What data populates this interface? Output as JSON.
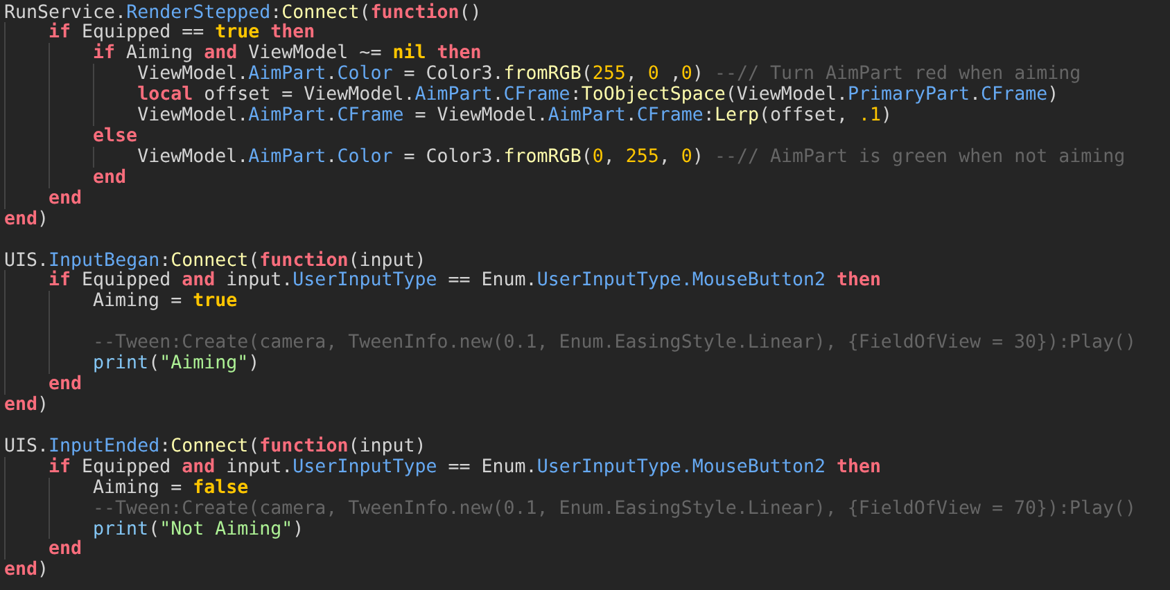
{
  "editor": {
    "lines": [
      {
        "tokens": [
          {
            "kind": "plain",
            "text": "RunService."
          },
          {
            "kind": "member",
            "text": "RenderStepped"
          },
          {
            "kind": "plain",
            "text": ":"
          },
          {
            "kind": "method",
            "text": "Connect"
          },
          {
            "kind": "plain",
            "text": "("
          },
          {
            "kind": "keyword",
            "text": "function"
          },
          {
            "kind": "plain",
            "text": "()"
          }
        ],
        "children": [
          {
            "tokens": [
              {
                "kind": "keyword",
                "text": "if"
              },
              {
                "kind": "plain",
                "text": " Equipped == "
              },
              {
                "kind": "literal",
                "text": "true "
              },
              {
                "kind": "keyword",
                "text": "then"
              }
            ],
            "children": [
              {
                "tokens": [
                  {
                    "kind": "keyword",
                    "text": "if"
                  },
                  {
                    "kind": "plain",
                    "text": " Aiming "
                  },
                  {
                    "kind": "keyword",
                    "text": "and"
                  },
                  {
                    "kind": "plain",
                    "text": " ViewModel ~= "
                  },
                  {
                    "kind": "literal",
                    "text": "nil "
                  },
                  {
                    "kind": "keyword",
                    "text": "then"
                  }
                ],
                "children": [
                  {
                    "tokens": [
                      {
                        "kind": "plain",
                        "text": "ViewModel."
                      },
                      {
                        "kind": "member",
                        "text": "AimPart"
                      },
                      {
                        "kind": "plain",
                        "text": "."
                      },
                      {
                        "kind": "member",
                        "text": "Color"
                      },
                      {
                        "kind": "plain",
                        "text": " = Color3."
                      },
                      {
                        "kind": "method",
                        "text": "fromRGB"
                      },
                      {
                        "kind": "plain",
                        "text": "("
                      },
                      {
                        "kind": "number",
                        "text": "255"
                      },
                      {
                        "kind": "plain",
                        "text": ", "
                      },
                      {
                        "kind": "number",
                        "text": "0"
                      },
                      {
                        "kind": "plain",
                        "text": " ,"
                      },
                      {
                        "kind": "number",
                        "text": "0"
                      },
                      {
                        "kind": "plain",
                        "text": ") "
                      },
                      {
                        "kind": "comment",
                        "text": "--// Turn AimPart red when aiming"
                      }
                    ]
                  },
                  {
                    "tokens": [
                      {
                        "kind": "keyword",
                        "text": "local"
                      },
                      {
                        "kind": "plain",
                        "text": " offset = ViewModel."
                      },
                      {
                        "kind": "member",
                        "text": "AimPart"
                      },
                      {
                        "kind": "plain",
                        "text": "."
                      },
                      {
                        "kind": "member",
                        "text": "CFrame"
                      },
                      {
                        "kind": "plain",
                        "text": ":"
                      },
                      {
                        "kind": "method",
                        "text": "ToObjectSpace"
                      },
                      {
                        "kind": "plain",
                        "text": "(ViewModel."
                      },
                      {
                        "kind": "member",
                        "text": "PrimaryPart"
                      },
                      {
                        "kind": "plain",
                        "text": "."
                      },
                      {
                        "kind": "member",
                        "text": "CFrame"
                      },
                      {
                        "kind": "plain",
                        "text": ")"
                      }
                    ]
                  },
                  {
                    "tokens": [
                      {
                        "kind": "plain",
                        "text": "ViewModel."
                      },
                      {
                        "kind": "member",
                        "text": "AimPart"
                      },
                      {
                        "kind": "plain",
                        "text": "."
                      },
                      {
                        "kind": "member",
                        "text": "CFrame"
                      },
                      {
                        "kind": "plain",
                        "text": " = ViewModel."
                      },
                      {
                        "kind": "member",
                        "text": "AimPart"
                      },
                      {
                        "kind": "plain",
                        "text": "."
                      },
                      {
                        "kind": "member",
                        "text": "CFrame"
                      },
                      {
                        "kind": "plain",
                        "text": ":"
                      },
                      {
                        "kind": "method",
                        "text": "Lerp"
                      },
                      {
                        "kind": "plain",
                        "text": "(offset, "
                      },
                      {
                        "kind": "number",
                        "text": ".1"
                      },
                      {
                        "kind": "plain",
                        "text": ")"
                      }
                    ]
                  }
                ]
              },
              {
                "tokens": [
                  {
                    "kind": "keyword",
                    "text": "else"
                  }
                ],
                "children": [
                  {
                    "tokens": [
                      {
                        "kind": "plain",
                        "text": "ViewModel."
                      },
                      {
                        "kind": "member",
                        "text": "AimPart"
                      },
                      {
                        "kind": "plain",
                        "text": "."
                      },
                      {
                        "kind": "member",
                        "text": "Color"
                      },
                      {
                        "kind": "plain",
                        "text": " = Color3."
                      },
                      {
                        "kind": "method",
                        "text": "fromRGB"
                      },
                      {
                        "kind": "plain",
                        "text": "("
                      },
                      {
                        "kind": "number",
                        "text": "0"
                      },
                      {
                        "kind": "plain",
                        "text": ", "
                      },
                      {
                        "kind": "number",
                        "text": "255"
                      },
                      {
                        "kind": "plain",
                        "text": ", "
                      },
                      {
                        "kind": "number",
                        "text": "0"
                      },
                      {
                        "kind": "plain",
                        "text": ") "
                      },
                      {
                        "kind": "comment",
                        "text": "--// AimPart is green when not aiming"
                      }
                    ]
                  }
                ]
              },
              {
                "tokens": [
                  {
                    "kind": "keyword",
                    "text": "end"
                  }
                ]
              }
            ]
          },
          {
            "tokens": [
              {
                "kind": "keyword",
                "text": "end"
              }
            ]
          }
        ]
      },
      {
        "tokens": [
          {
            "kind": "keyword",
            "text": "end"
          },
          {
            "kind": "plain",
            "text": ")"
          }
        ]
      },
      {
        "kind": "blank"
      },
      {
        "tokens": [
          {
            "kind": "plain",
            "text": "UIS."
          },
          {
            "kind": "member",
            "text": "InputBegan"
          },
          {
            "kind": "plain",
            "text": ":"
          },
          {
            "kind": "method",
            "text": "Connect"
          },
          {
            "kind": "plain",
            "text": "("
          },
          {
            "kind": "keyword",
            "text": "function"
          },
          {
            "kind": "plain",
            "text": "(input)"
          }
        ],
        "children": [
          {
            "tokens": [
              {
                "kind": "keyword",
                "text": "if"
              },
              {
                "kind": "plain",
                "text": " Equipped "
              },
              {
                "kind": "keyword",
                "text": "and"
              },
              {
                "kind": "plain",
                "text": " input."
              },
              {
                "kind": "member",
                "text": "UserInputType"
              },
              {
                "kind": "plain",
                "text": " == Enum."
              },
              {
                "kind": "member",
                "text": "UserInputType"
              },
              {
                "kind": "member",
                "text": ".MouseButton2 "
              },
              {
                "kind": "keyword",
                "text": "then"
              }
            ],
            "children": [
              {
                "tokens": [
                  {
                    "kind": "plain",
                    "text": "Aiming = "
                  },
                  {
                    "kind": "literal",
                    "text": "true"
                  }
                ]
              },
              {
                "kind": "blank"
              },
              {
                "tokens": [
                  {
                    "kind": "comment",
                    "text": "--Tween:Create(camera, TweenInfo.new(0.1, Enum.EasingStyle.Linear), {FieldOfView = 30}):Play()"
                  }
                ]
              },
              {
                "tokens": [
                  {
                    "kind": "builtin",
                    "text": "print"
                  },
                  {
                    "kind": "plain",
                    "text": "("
                  },
                  {
                    "kind": "string",
                    "text": "\"Aiming\""
                  },
                  {
                    "kind": "plain",
                    "text": ")"
                  }
                ]
              }
            ]
          },
          {
            "tokens": [
              {
                "kind": "keyword",
                "text": "end"
              }
            ]
          }
        ]
      },
      {
        "tokens": [
          {
            "kind": "keyword",
            "text": "end"
          },
          {
            "kind": "plain",
            "text": ")"
          }
        ]
      },
      {
        "kind": "blank"
      },
      {
        "tokens": [
          {
            "kind": "plain",
            "text": "UIS."
          },
          {
            "kind": "member",
            "text": "InputEnded"
          },
          {
            "kind": "plain",
            "text": ":"
          },
          {
            "kind": "method",
            "text": "Connect"
          },
          {
            "kind": "plain",
            "text": "("
          },
          {
            "kind": "keyword",
            "text": "function"
          },
          {
            "kind": "plain",
            "text": "(input)"
          }
        ],
        "children": [
          {
            "tokens": [
              {
                "kind": "keyword",
                "text": "if"
              },
              {
                "kind": "plain",
                "text": " Equipped "
              },
              {
                "kind": "keyword",
                "text": "and"
              },
              {
                "kind": "plain",
                "text": " input."
              },
              {
                "kind": "member",
                "text": "UserInputType"
              },
              {
                "kind": "plain",
                "text": " == Enum."
              },
              {
                "kind": "member",
                "text": "UserInputType"
              },
              {
                "kind": "member",
                "text": ".MouseButton2 "
              },
              {
                "kind": "keyword",
                "text": "then"
              }
            ],
            "children": [
              {
                "tokens": [
                  {
                    "kind": "plain",
                    "text": "Aiming = "
                  },
                  {
                    "kind": "literal",
                    "text": "false"
                  }
                ]
              },
              {
                "tokens": [
                  {
                    "kind": "comment",
                    "text": "--Tween:Create(camera, TweenInfo.new(0.1, Enum.EasingStyle.Linear), {FieldOfView = 70}):Play()"
                  }
                ]
              },
              {
                "tokens": [
                  {
                    "kind": "builtin",
                    "text": "print"
                  },
                  {
                    "kind": "plain",
                    "text": "("
                  },
                  {
                    "kind": "string",
                    "text": "\"Not Aiming\""
                  },
                  {
                    "kind": "plain",
                    "text": ")"
                  }
                ]
              }
            ]
          },
          {
            "tokens": [
              {
                "kind": "keyword",
                "text": "end"
              }
            ]
          }
        ]
      },
      {
        "tokens": [
          {
            "kind": "keyword",
            "text": "end"
          },
          {
            "kind": "plain",
            "text": ")"
          }
        ]
      }
    ]
  }
}
